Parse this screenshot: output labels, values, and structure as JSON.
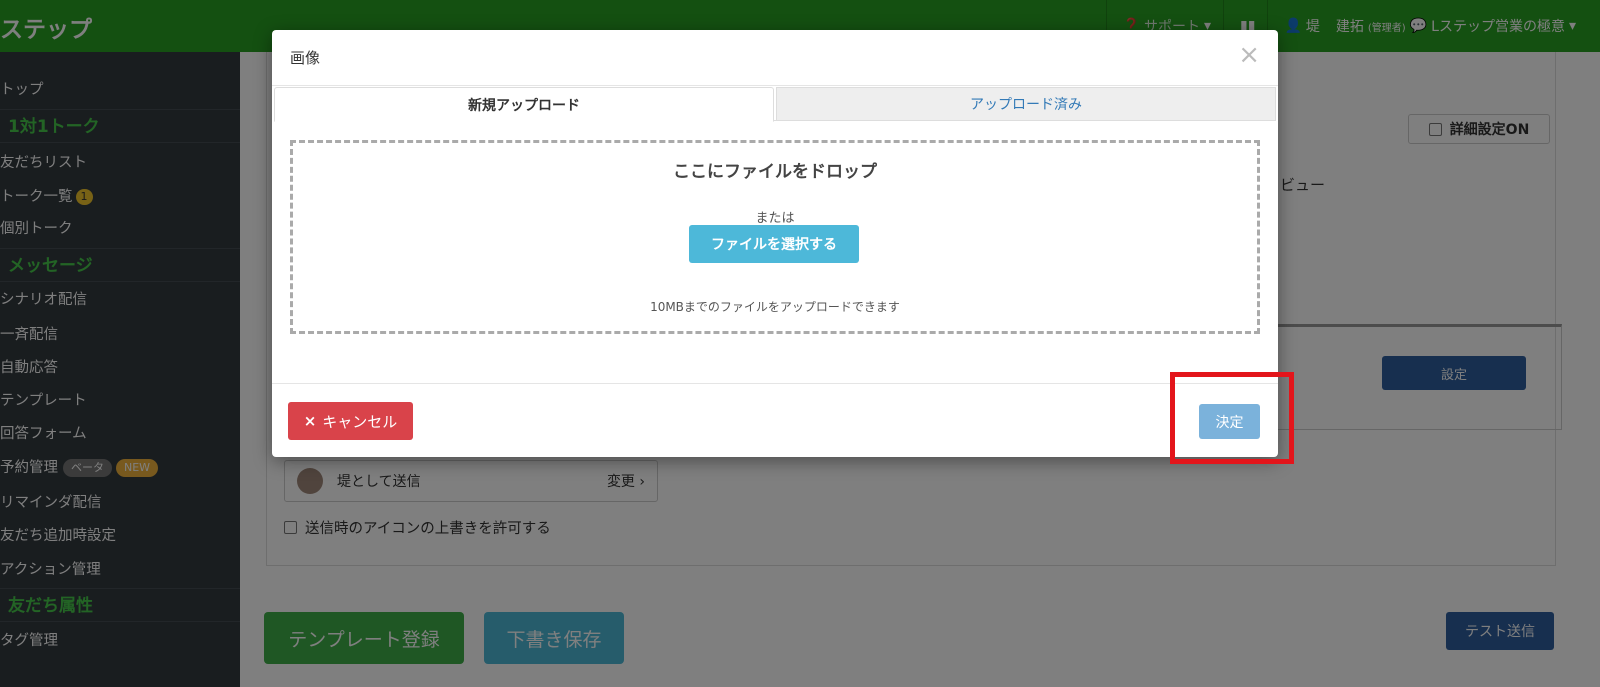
{
  "topbar": {
    "brand": "ステップ",
    "support": "サポート",
    "user_name": "堤",
    "admin_name": "建拓",
    "admin_role": "(管理者)",
    "account_name": "Lステップ営業の極意"
  },
  "sidebar": {
    "items": [
      {
        "label": "トップ"
      },
      {
        "label": "友だちリスト"
      },
      {
        "label": "トーク一覧",
        "badge": "1"
      },
      {
        "label": "個別トーク"
      },
      {
        "label": "シナリオ配信"
      },
      {
        "label": "一斉配信"
      },
      {
        "label": "自動応答"
      },
      {
        "label": "テンプレート"
      },
      {
        "label": "回答フォーム"
      },
      {
        "label": "予約管理",
        "badge_beta": "ベータ",
        "badge_new": "NEW"
      },
      {
        "label": "リマインダ配信"
      },
      {
        "label": "友だち追加時設定"
      },
      {
        "label": "アクション管理"
      },
      {
        "label": "タグ管理"
      }
    ],
    "sections": [
      "1対1トーク",
      "メッセージ",
      "友だち属性"
    ]
  },
  "main": {
    "detail_toggle": "詳細設定ON",
    "preview_label": "ビュー",
    "set_button": "設定",
    "sender_name": "堤として送信",
    "sender_change": "変更",
    "override_label": "送信時のアイコンの上書きを許可する",
    "template_button": "テンプレート登録",
    "draft_button": "下書き保存",
    "test_button": "テスト送信"
  },
  "modal": {
    "title": "画像",
    "tabs": [
      "新規アップロード",
      "アップロード済み"
    ],
    "drop_title": "ここにファイルをドロップ",
    "drop_or": "または",
    "select_button": "ファイルを選択する",
    "drop_note": "10MBまでのファイルをアップロードできます",
    "cancel_button": "キャンセル",
    "ok_button": "決定"
  },
  "colors": {
    "brand_green": "#28a122",
    "sidebar_bg": "#333a3f",
    "highlight": "#e3151b"
  }
}
